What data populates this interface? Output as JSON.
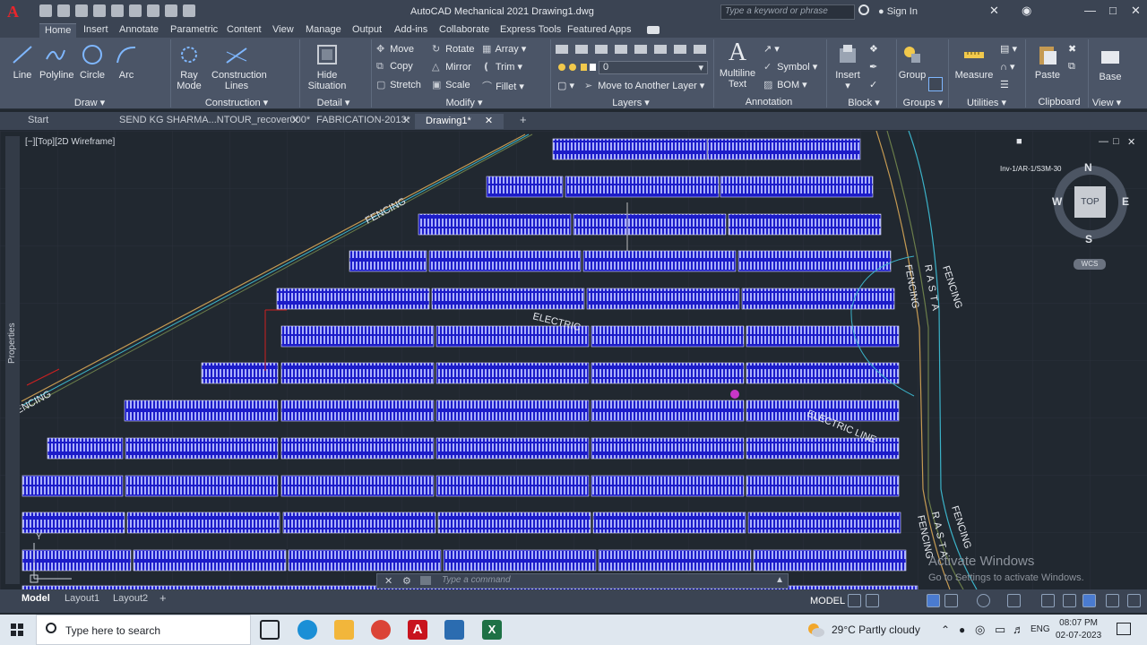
{
  "app": {
    "title": "AutoCAD Mechanical 2021    Drawing1.dwg",
    "search_placeholder": "Type a keyword or phrase",
    "sign_in": "Sign In",
    "logo_letter": "A"
  },
  "ribbon_tabs": [
    "Home",
    "Insert",
    "Annotate",
    "Parametric",
    "Content",
    "View",
    "Manage",
    "Output",
    "Add-ins",
    "Collaborate",
    "Express Tools",
    "Featured Apps"
  ],
  "ribbon": {
    "draw": {
      "line": "Line",
      "polyline": "Polyline",
      "circle": "Circle",
      "arc": "Arc",
      "title": "Draw"
    },
    "construction": {
      "ray1": "Ray",
      "ray2": "Mode",
      "cons1": "Construction",
      "cons2": "Lines",
      "title": "Construction"
    },
    "detail": {
      "hide1": "Hide",
      "hide2": "Situation",
      "title": "Detail"
    },
    "modify": {
      "move": "Move",
      "rotate": "Rotate",
      "array": "Array",
      "copy": "Copy",
      "mirror": "Mirror",
      "trim": "Trim",
      "stretch": "Stretch",
      "scale": "Scale",
      "fillet": "Fillet",
      "title": "Modify"
    },
    "layers": {
      "current": "0",
      "move_layer": "Move to Another Layer",
      "title": "Layers"
    },
    "annotation": {
      "mtext1": "Multiline",
      "mtext2": "Text",
      "symbol": "Symbol",
      "bom": "BOM",
      "title": "Annotation"
    },
    "block": {
      "insert": "Insert",
      "title": "Block"
    },
    "groups": {
      "group": "Group",
      "title": "Groups"
    },
    "utilities": {
      "measure": "Measure",
      "title": "Utilities"
    },
    "clipboard": {
      "paste": "Paste",
      "title": "Clipboard"
    },
    "view": {
      "base": "Base",
      "title": "View"
    }
  },
  "file_tabs": [
    "Start",
    "SEND  KG  SHARMA...NTOUR_recover000*",
    "FABRICATION-2013*",
    "Drawing1*"
  ],
  "viewport": {
    "label": "[−][Top][2D Wireframe]",
    "properties": "Properties",
    "inv_label": "Inv-1/AR-1/S3M-30",
    "compass": {
      "n": "N",
      "s": "S",
      "e": "E",
      "w": "W",
      "top": "TOP",
      "wcs": "WCS"
    },
    "texts": {
      "fencing_diag": "FENCING",
      "fencing_left": "ENCING",
      "electric1": "ELECTRIC",
      "electric2": "ELECTRIC LINE",
      "fencing_r1": "FENCING",
      "rasta1": "RASTA",
      "fencing_r2": "FENCING",
      "fencing_r3": "FENCING",
      "rasta2": "RASTA",
      "fencing_r4": "FENCING"
    }
  },
  "watermark": {
    "line1": "Activate Windows",
    "line2": "Go to Settings to activate Windows."
  },
  "command": {
    "placeholder": "Type a command"
  },
  "layout_tabs": [
    "Model",
    "Layout1",
    "Layout2"
  ],
  "status": {
    "model": "MODEL"
  },
  "taskbar": {
    "search": "Type here to search",
    "weather": "29°C  Partly cloudy",
    "lang": "ENG",
    "time": "08:07 PM",
    "date": "02-07-2023"
  }
}
